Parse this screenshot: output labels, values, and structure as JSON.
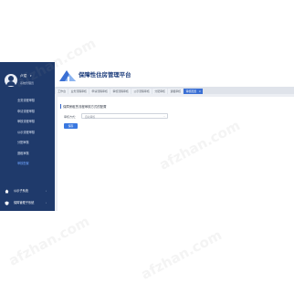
{
  "header": {
    "app_title": "保障性住房管理平台"
  },
  "user": {
    "name": "卢斌",
    "role": "系统管理员"
  },
  "sidebar": {
    "items": [
      {
        "label": "业务流程审核"
      },
      {
        "label": "申请流程审核"
      },
      {
        "label": "审核流程审核"
      },
      {
        "label": "公示流程审核"
      },
      {
        "label": "分配审核"
      },
      {
        "label": "退租审核"
      },
      {
        "label": "审核配置"
      }
    ],
    "bottom": [
      {
        "label": "公示子系统",
        "icon": "home-icon"
      },
      {
        "label": "保障管理子系统",
        "icon": "shield-icon"
      }
    ]
  },
  "tabs": [
    {
      "label": "工作台"
    },
    {
      "label": "业务流程审核"
    },
    {
      "label": "申请流程审核"
    },
    {
      "label": "审核流程审核"
    },
    {
      "label": "公示流程审核"
    },
    {
      "label": "分配审核"
    },
    {
      "label": "退租审核"
    },
    {
      "label": "审核配置",
      "active": true,
      "close": "×"
    }
  ],
  "content": {
    "section_title": "保障房租赁流程审核方式的配置",
    "form_label": "审核方式：",
    "select_value": "自动审核",
    "save_label": "保存"
  },
  "watermark": "afzhan.com",
  "colors": {
    "sidebar_bg": "#1f3a6b",
    "accent": "#3a6fd4",
    "title": "#1d3d7c"
  }
}
